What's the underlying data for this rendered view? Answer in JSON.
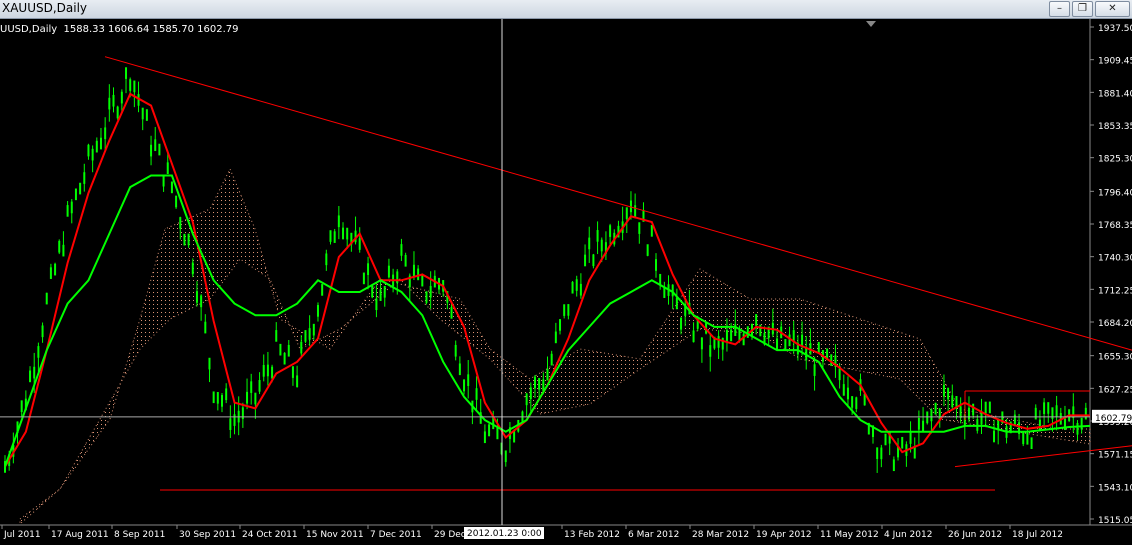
{
  "window": {
    "title": "XAUUSD,Daily",
    "buttons": [
      "minimize-icon",
      "restore-icon",
      "close-icon"
    ]
  },
  "info_line": "UUSD,Daily  1588.33 1606.64 1585.70 1602.79",
  "price_marker": "1602.79",
  "crosshair_label": "2012.01.23 0:00",
  "colors": {
    "background": "#000000",
    "candles": "#00ff00",
    "tenkan": "#ff0000",
    "kijun": "#00ff00",
    "cloud": "#f4a582",
    "trendlines": "#ff0000",
    "axis_text": "#ffffff"
  },
  "chart_data": {
    "type": "line",
    "symbol": "XAUUSD",
    "timeframe": "Daily",
    "y_ticks": [
      "1937.50",
      "1909.45",
      "1881.40",
      "1853.35",
      "1825.30",
      "1796.40",
      "1768.35",
      "1740.30",
      "1712.25",
      "1684.20",
      "1655.30",
      "1627.25",
      "1599.20",
      "1571.15",
      "1543.10",
      "1515.05"
    ],
    "x_ticks": [
      "Jul 2011",
      "17 Aug 2011",
      "8 Sep 2011",
      "30 Sep 2011",
      "24 Oct 2011",
      "15 Nov 2011",
      "7 Dec 2011",
      "29 Dec",
      "13 Feb 2012",
      "6 Mar 2012",
      "28 Mar 2012",
      "19 Apr 2012",
      "11 May 2012",
      "4 Jun 2012",
      "26 Jun 2012",
      "18 Jul 2012"
    ],
    "ylim": [
      1515.05,
      1937.5
    ],
    "last_close": 1602.79,
    "series": [
      {
        "values": [
          1560,
          1620,
          1700,
          1770,
          1820,
          1860,
          1900,
          1840,
          1800,
          1740,
          1630,
          1600,
          1620,
          1660,
          1640,
          1700,
          1780,
          1740,
          1700,
          1740,
          1710,
          1720,
          1640,
          1590,
          1580,
          1620,
          1640,
          1700,
          1740,
          1760,
          1790,
          1750,
          1700,
          1680,
          1660,
          1670,
          1690,
          1665,
          1665,
          1650,
          1640,
          1620,
          1575,
          1570,
          1590,
          1620,
          1610,
          1600,
          1595,
          1590,
          1600,
          1608,
          1600
        ]
      },
      {
        "name": "",
        "values": [
          1560,
          1610,
          1660,
          1700,
          1720,
          1760,
          1800,
          1810,
          1810,
          1760,
          1720,
          1700,
          1690,
          1690,
          1700,
          1720,
          1710,
          1710,
          1720,
          1710,
          1690,
          1650,
          1620,
          1600,
          1590,
          1600,
          1630,
          1660,
          1680,
          1700,
          1710,
          1720,
          1710,
          1690,
          1680,
          1680,
          1670,
          1660,
          1660,
          1650,
          1620,
          1600,
          1590,
          1590,
          1590,
          1590,
          1595,
          1595,
          1590,
          1590,
          1592,
          1594,
          1595
        ]
      }
    ],
    "trendlines": [
      {
        "from": [
          "8 Sep 2011",
          1912
        ],
        "to": [
          "end",
          1660
        ]
      },
      {
        "from": [
          "30 Sep 2011",
          1540
        ],
        "to": [
          "26 Jun 2012",
          1540
        ]
      },
      {
        "from": [
          "26 Jun 2012",
          1560
        ],
        "to": [
          "end",
          1575
        ]
      },
      {
        "from": [
          "26 Jun 2012",
          1625
        ],
        "to": [
          "end",
          1625
        ]
      }
    ]
  }
}
